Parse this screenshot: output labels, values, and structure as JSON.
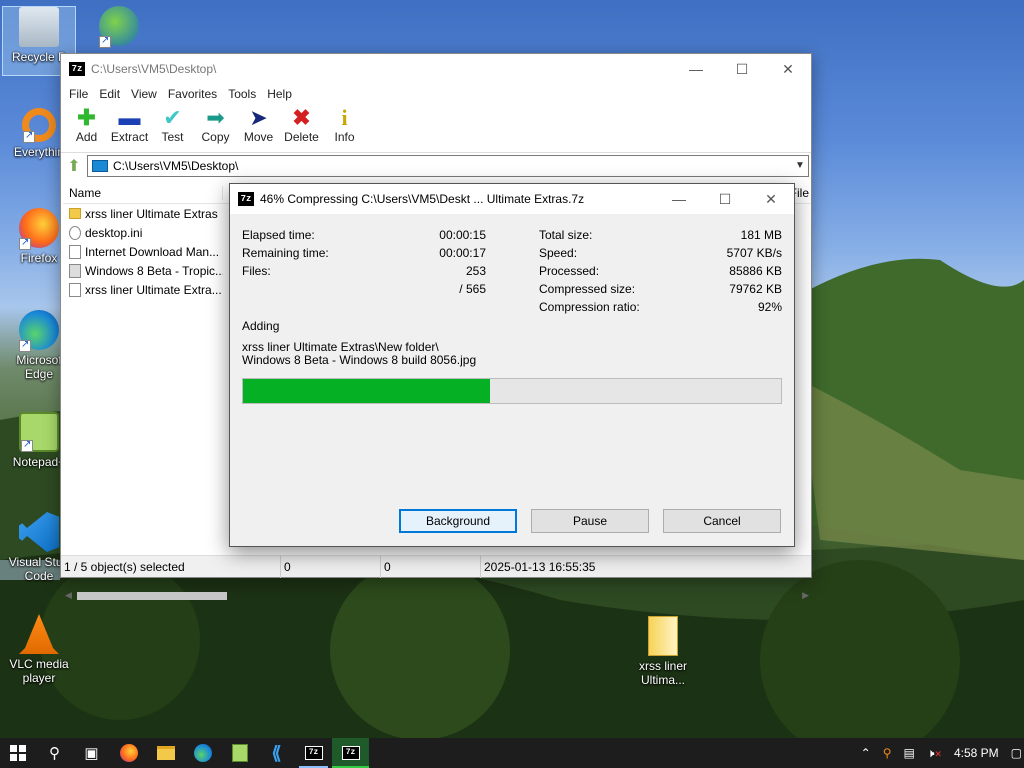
{
  "desktop": {
    "icons": [
      {
        "label": "Recycle Bin",
        "display": "Recycle B"
      },
      {
        "label": "Internet Download Manager",
        "display": ""
      },
      {
        "label": "Everything",
        "display": "Everythin"
      },
      {
        "label": "Firefox",
        "display": "Firefox"
      },
      {
        "label": "Microsoft Edge",
        "display": "Microsof Edge"
      },
      {
        "label": "Notepad++",
        "display": "Notepad+"
      },
      {
        "label": "Visual Studio Code",
        "display": "Visual Stud Code"
      },
      {
        "label": "VLC media player",
        "display": "VLC media player"
      },
      {
        "label": "xrss liner Ultima...",
        "display": "xrss liner Ultima..."
      }
    ]
  },
  "main_window": {
    "title": "C:\\Users\\VM5\\Desktop\\",
    "menu": [
      "File",
      "Edit",
      "View",
      "Favorites",
      "Tools",
      "Help"
    ],
    "toolbar": [
      {
        "label": "Add",
        "icon": "plus-icon",
        "color": "#2fb82f"
      },
      {
        "label": "Extract",
        "icon": "minus-icon",
        "color": "#1b3fb5"
      },
      {
        "label": "Test",
        "icon": "check-icon",
        "color": "#3fc7c7"
      },
      {
        "label": "Copy",
        "icon": "double-arrow-icon",
        "color": "#1a9b8a"
      },
      {
        "label": "Move",
        "icon": "arrow-right-icon",
        "color": "#16287a"
      },
      {
        "label": "Delete",
        "icon": "x-icon",
        "color": "#d42020"
      },
      {
        "label": "Info",
        "icon": "info-icon",
        "color": "#c9a800"
      }
    ],
    "address": "C:\\Users\\VM5\\Desktop\\",
    "columns": {
      "name": "Name",
      "file": "File"
    },
    "files": [
      {
        "name": "xrss liner Ultimate Extras",
        "type": "folder"
      },
      {
        "name": "desktop.ini",
        "type": "ini"
      },
      {
        "name": "Internet Download Man...",
        "type": "file"
      },
      {
        "name": "Windows 8 Beta - Tropic...",
        "type": "image"
      },
      {
        "name": "xrss liner Ultimate Extra...",
        "type": "file"
      }
    ],
    "status": {
      "selected": "1 / 5 object(s) selected",
      "size": "0",
      "packed": "0",
      "modified": "2025-01-13 16:55:35"
    }
  },
  "dialog": {
    "title": "46% Compressing C:\\Users\\VM5\\Deskt ... Ultimate Extras.7z",
    "left": [
      {
        "label": "Elapsed time:",
        "value": "00:00:15"
      },
      {
        "label": "Remaining time:",
        "value": "00:00:17"
      },
      {
        "label": "Files:",
        "value": "253"
      },
      {
        "label": "",
        "value": "/ 565"
      }
    ],
    "right": [
      {
        "label": "Total size:",
        "value": "181 MB"
      },
      {
        "label": "Speed:",
        "value": "5707 KB/s"
      },
      {
        "label": "Processed:",
        "value": "85886 KB"
      },
      {
        "label": "Compressed size:",
        "value": "79762 KB"
      },
      {
        "label": "Compression ratio:",
        "value": "92%"
      }
    ],
    "action": "Adding",
    "current_path": "xrss liner Ultimate Extras\\New folder\\",
    "current_file": "Windows 8 Beta - Windows 8 build 8056.jpg",
    "progress": 0.46,
    "buttons": {
      "background": "Background",
      "pause": "Pause",
      "cancel": "Cancel"
    }
  },
  "taskbar": {
    "clock": "4:58 PM"
  }
}
